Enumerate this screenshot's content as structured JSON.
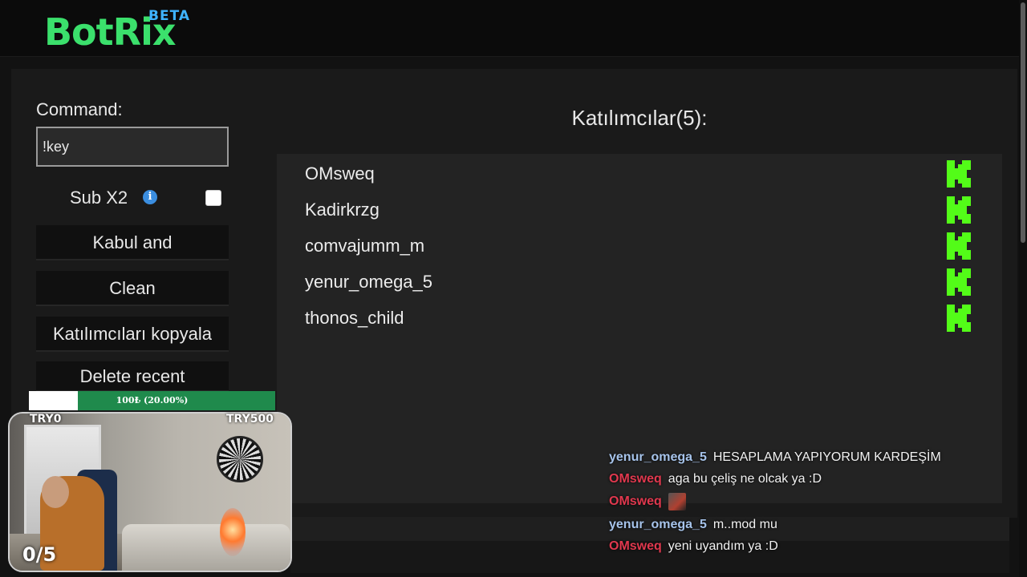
{
  "header": {
    "logo": "BotRix",
    "badge": "BETA"
  },
  "colors": {
    "brand": "#3be06c",
    "badge": "#3fb3ff",
    "kick_green": "#53fc18",
    "goal_bar": "#1f8a4c"
  },
  "controls": {
    "command_label": "Command:",
    "command_value": "!key",
    "sub_label": "Sub X2",
    "info_icon": "i",
    "sub_checked": false,
    "buttons": [
      "Kabul and",
      "Clean",
      "Katılımcıları kopyala",
      "Delete recent"
    ]
  },
  "participants": {
    "title": "Katılımcılar(5):",
    "items": [
      "OMsweq",
      "Kadirkrzg",
      "comvajumm_m",
      "yenur_omega_5",
      "thonos_child"
    ],
    "platform_icon": "kick-logo-icon"
  },
  "stream": {
    "goal_text": "100₺ (20.00%)",
    "goal_progress": 0.2,
    "goal_min": "TRY0",
    "goal_max": "TRY500",
    "counter": "0/5"
  },
  "chat": [
    {
      "user": "yenur_omega_5",
      "color": "#a6c3ea",
      "message": "HESAPLAMA YAPIYORUM KARDEŞİM"
    },
    {
      "user": "OMsweq",
      "color": "#e0384e",
      "message": "aga bu çeliş ne olcak ya :D"
    },
    {
      "user": "OMsweq",
      "color": "#e0384e",
      "message": "",
      "emote": "emote-icon"
    },
    {
      "user": "yenur_omega_5",
      "color": "#a6c3ea",
      "message": "m..mod mu"
    },
    {
      "user": "OMsweq",
      "color": "#e0384e",
      "message": "yeni uyandım ya :D"
    }
  ]
}
